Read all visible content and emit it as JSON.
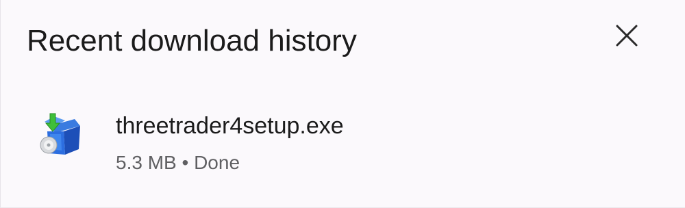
{
  "panel": {
    "title": "Recent download history",
    "close_icon": "close-icon"
  },
  "downloads": [
    {
      "file_name": "threetrader4setup.exe",
      "size": "5.3 MB",
      "separator": "•",
      "status": "Done",
      "icon": "installer-package-icon"
    }
  ],
  "colors": {
    "background": "#fbf9fc",
    "title_text": "#1b1b1b",
    "meta_text": "#5f5f62"
  }
}
